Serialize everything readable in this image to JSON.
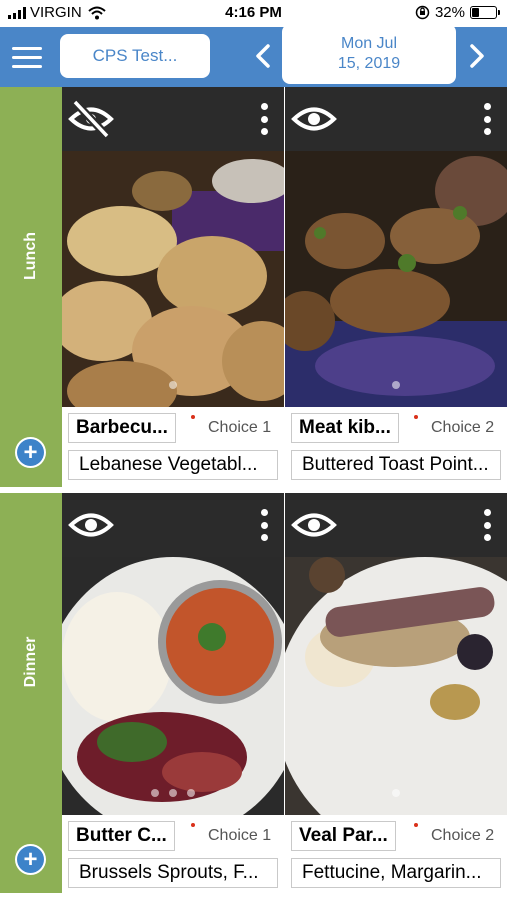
{
  "status_bar": {
    "carrier": "VIRGIN",
    "time": "4:16 PM",
    "battery": "32%",
    "battery_level": 0.32
  },
  "header": {
    "school_name": "CPS Test...",
    "date_line1": "Mon Jul",
    "date_line2": "15, 2019"
  },
  "meals": [
    {
      "name": "Lunch",
      "items": [
        {
          "entree": "Barbecu...",
          "choice": "Choice 1",
          "side": "Lebanese Vegetabl...",
          "visible": false
        },
        {
          "entree": "Meat kib...",
          "choice": "Choice 2",
          "side": "Buttered Toast Point...",
          "visible": true
        }
      ]
    },
    {
      "name": "Dinner",
      "items": [
        {
          "entree": "Butter C...",
          "choice": "Choice 1",
          "side": "Brussels Sprouts, F...",
          "visible": true
        },
        {
          "entree": "Veal Par...",
          "choice": "Choice 2",
          "side": "Fettucine, Margarin...",
          "visible": true
        }
      ]
    }
  ],
  "colors": {
    "header": "#4a86c8",
    "sidebar": "#8db055",
    "add_button": "#3d83c9",
    "required_dot": "#d9301a"
  }
}
